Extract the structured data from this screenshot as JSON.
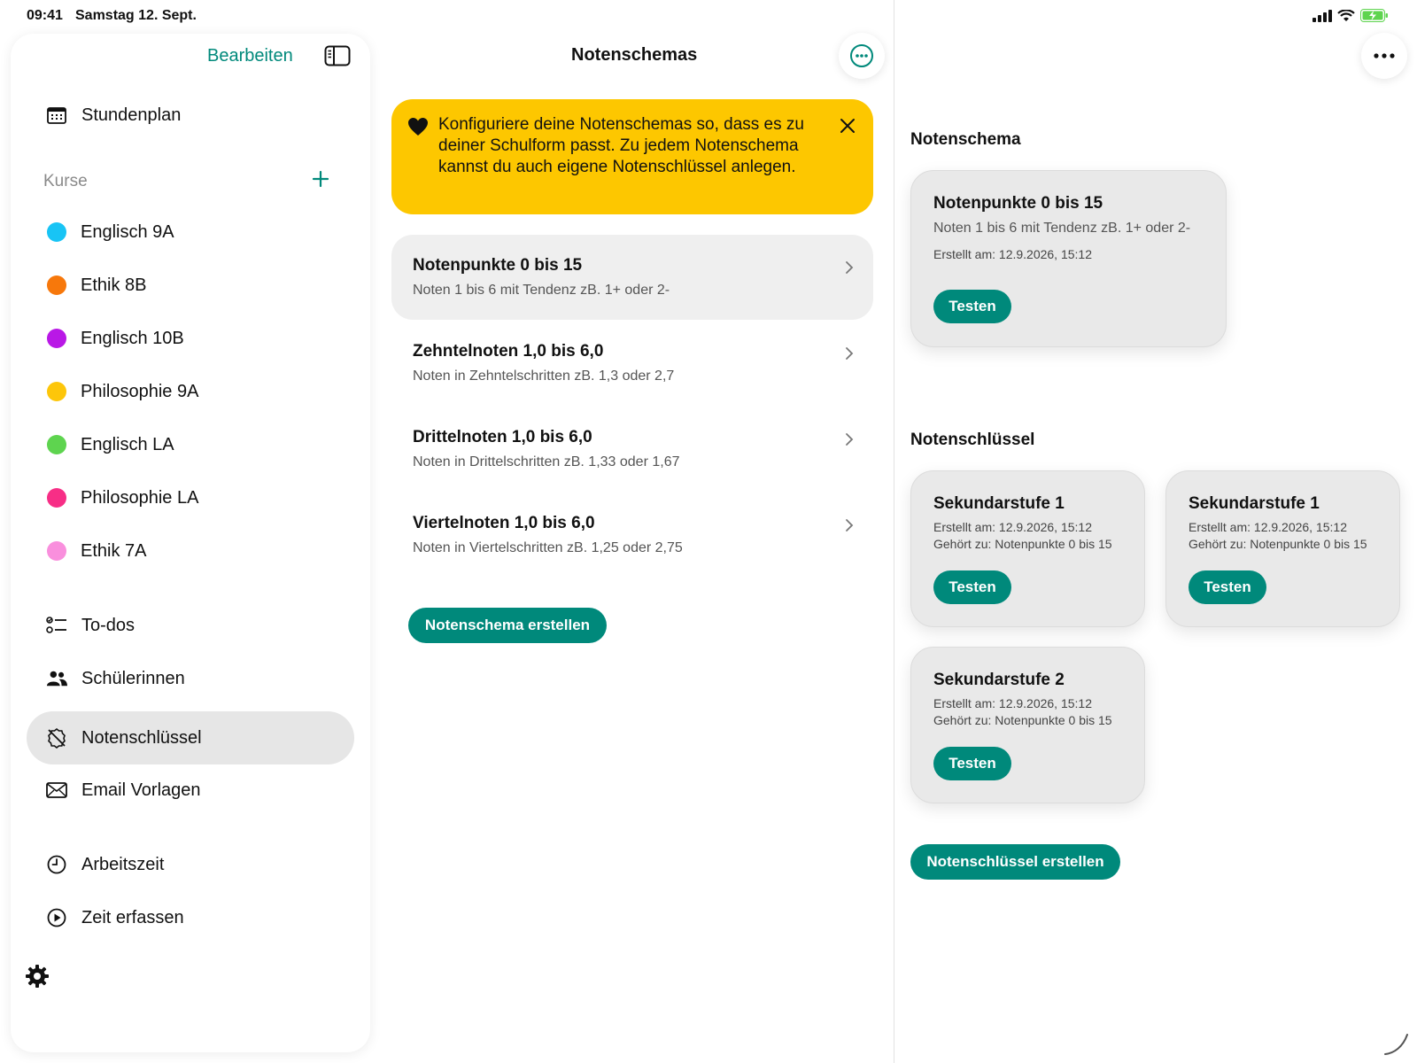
{
  "status": {
    "time": "09:41",
    "date": "Samstag 12. Sept."
  },
  "sidebar": {
    "edit_label": "Bearbeiten",
    "stundenplan": "Stundenplan",
    "courses_header": "Kurse",
    "courses": [
      {
        "label": "Englisch 9A",
        "color": "#18c4f5"
      },
      {
        "label": "Ethik 8B",
        "color": "#f7780b"
      },
      {
        "label": "Englisch 10B",
        "color": "#b918e6"
      },
      {
        "label": "Philosophie 9A",
        "color": "#fdc60a"
      },
      {
        "label": "Englisch LA",
        "color": "#5ed44f"
      },
      {
        "label": "Philosophie LA",
        "color": "#f72e86"
      },
      {
        "label": "Ethik 7A",
        "color": "#f98fdd"
      }
    ],
    "todos": "To-dos",
    "students": "Schülerinnen",
    "grading_keys": "Notenschlüssel",
    "email_templates": "Email Vorlagen",
    "work_time": "Arbeitszeit",
    "track_time": "Zeit erfassen"
  },
  "middle": {
    "title": "Notenschemas",
    "banner_text": "Konfiguriere deine Notenschemas so, dass es zu deiner Schulform passt. Zu jedem Notenschema kannst du auch eigene Notenschlüssel anlegen.",
    "schemas": [
      {
        "title": "Notenpunkte 0 bis 15",
        "subtitle": "Noten 1 bis 6 mit Tendenz zB. 1+ oder 2-"
      },
      {
        "title": "Zehntelnoten 1,0 bis 6,0",
        "subtitle": "Noten in Zehntelschritten zB. 1,3 oder 2,7"
      },
      {
        "title": "Drittelnoten 1,0 bis 6,0",
        "subtitle": "Noten in Drittelschritten zB. 1,33 oder 1,67"
      },
      {
        "title": "Viertelnoten 1,0 bis 6,0",
        "subtitle": "Noten in Viertelschritten zB. 1,25 oder 2,75"
      }
    ],
    "create_label": "Notenschema erstellen"
  },
  "right": {
    "schema_heading": "Notenschema",
    "schema_card": {
      "title": "Notenpunkte 0 bis 15",
      "subtitle": "Noten 1 bis 6 mit Tendenz zB. 1+ oder 2-",
      "created": "Erstellt am: 12.9.2026, 15:12",
      "test_label": "Testen"
    },
    "keys_heading": "Notenschlüssel",
    "keys": [
      {
        "title": "Sekundarstufe 1",
        "created": "Erstellt am: 12.9.2026, 15:12",
        "belongs": "Gehört zu: Notenpunkte 0 bis 15",
        "test_label": "Testen"
      },
      {
        "title": "Sekundarstufe 1",
        "created": "Erstellt am: 12.9.2026, 15:12",
        "belongs": "Gehört zu: Notenpunkte 0 bis 15",
        "test_label": "Testen"
      },
      {
        "title": "Sekundarstufe 2",
        "created": "Erstellt am: 12.9.2026, 15:12",
        "belongs": "Gehört zu: Notenpunkte 0 bis 15",
        "test_label": "Testen"
      }
    ],
    "create_key_label": "Notenschlüssel erstellen"
  },
  "colors": {
    "accent": "#00897b",
    "banner": "#fdc700",
    "selected_bg": "#e6e6e6"
  }
}
